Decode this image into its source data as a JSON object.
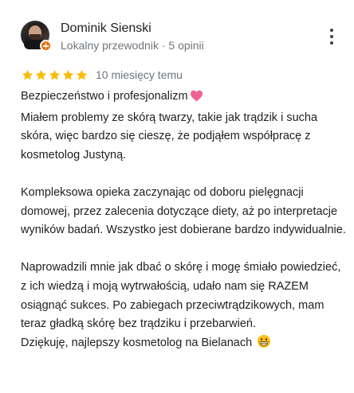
{
  "author": {
    "name": "Dominik Sienski",
    "meta": "Lokalny przewodnik · 5 opinii",
    "avatar_icon": "user-avatar-photo",
    "badge_icon": "local-guide-badge-icon",
    "badge_color": "#e8710a"
  },
  "review": {
    "rating": 5,
    "max_rating": 5,
    "star_color": "#fbbc04",
    "date": "10 miesięcy temu",
    "lines": [
      "Bezpieczeństwo i profesjonalizm",
      "Miałem problemy ze skórą twarzy, takie jak trądzik i sucha skóra, więc bardzo się cieszę, że podjąłem współpracę z kosmetolog Justyną.",
      "",
      "Kompleksowa opieka zaczynając od doboru pielęgnacji domowej, przez zalecenia dotyczące diety, aż po interpretacje wyników badań. Wszystko jest dobierane bardzo indywidualnie.",
      "",
      "Naprowadzili mnie jak dbać o skórę i mogę śmiało powiedzieć, z ich wiedzą i moją wytrwałością, udało nam się RAZEM osiągnąć sukces. Po zabiegach przeciwtrądzikowych, mam teraz gładką skórę bez trądziku i przebarwień.",
      "Dziękuję, najlepszy kosmetolog na Bielanach"
    ],
    "heart_icon": "pink-heart-icon",
    "grin_icon": "grinning-face-emoji-icon"
  },
  "menu_icon": "more-vertical-icon"
}
